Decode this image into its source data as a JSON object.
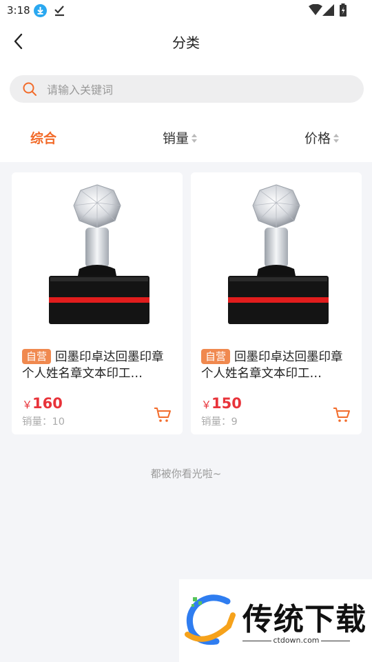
{
  "status_bar": {
    "time": "3:18"
  },
  "header": {
    "title": "分类"
  },
  "search": {
    "placeholder": "请输入关键词"
  },
  "sort_tabs": [
    {
      "label": "综合",
      "active": true
    },
    {
      "label": "销量",
      "active": false
    },
    {
      "label": "价格",
      "active": false
    }
  ],
  "products": [
    {
      "badge": "自营",
      "name": "回墨印卓达回墨印章个人姓名章文本印工…",
      "currency": "￥",
      "price": "160",
      "sales": "销量：10"
    },
    {
      "badge": "自营",
      "name": "回墨印卓达回墨印章个人姓名章文本印工…",
      "currency": "￥",
      "price": "150",
      "sales": "销量：9"
    }
  ],
  "footer": {
    "end_text": "都被你看光啦~"
  },
  "watermark": {
    "title": "传统下载",
    "url": "ctdown.com"
  },
  "colors": {
    "accent": "#f26b2a",
    "price": "#e8333a",
    "badge": "#f0894f",
    "background": "#f4f5f8"
  }
}
